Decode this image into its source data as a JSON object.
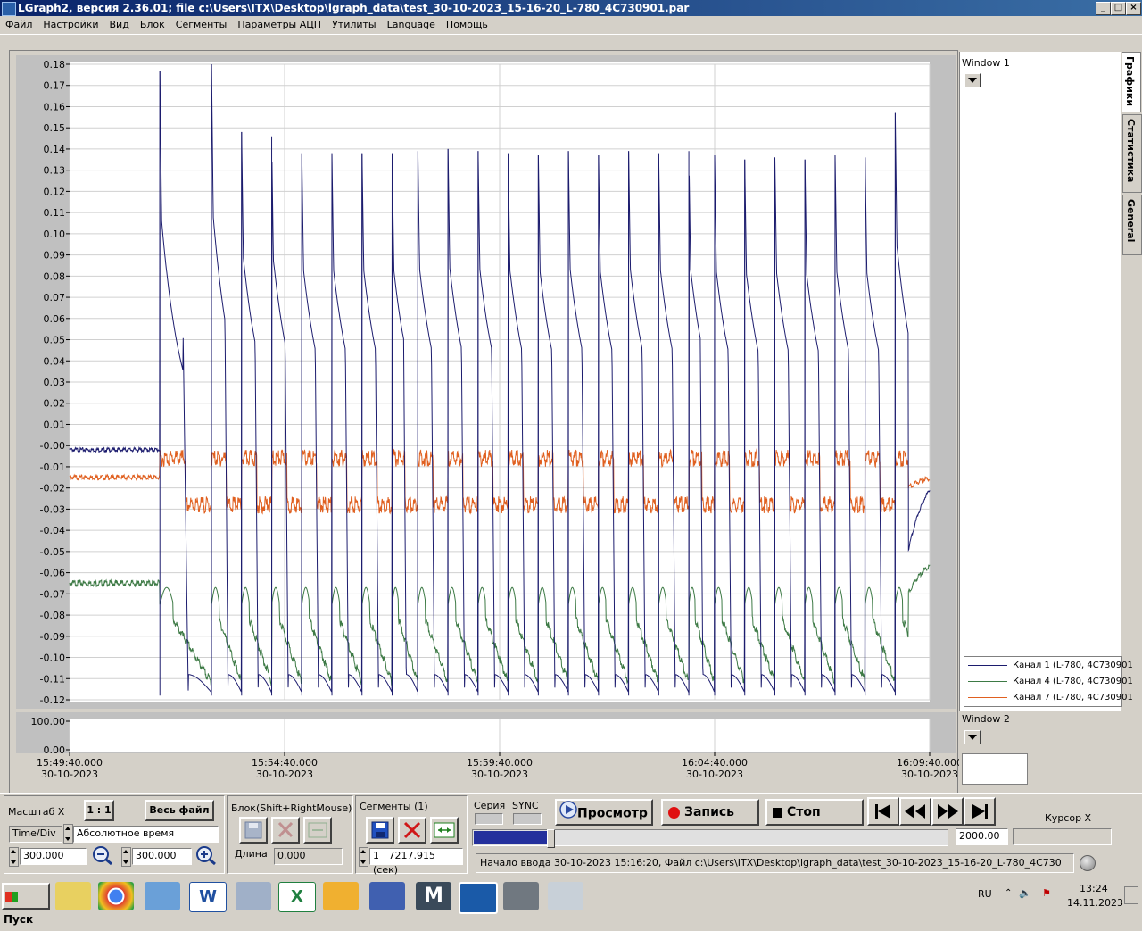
{
  "window": {
    "title": "LGraph2, версия  2.36.01; file c:\\Users\\ITX\\Desktop\\lgraph_data\\test_30-10-2023_15-16-20_L-780_4C730901.par",
    "min_label": "_",
    "max_label": "□",
    "close_label": "×"
  },
  "menu": [
    "Файл",
    "Настройки",
    "Вид",
    "Блок",
    "Сегменты",
    "Параметры АЦП",
    "Утилиты",
    "Language",
    "Помощь"
  ],
  "main_plot": {
    "y_ticks": [
      "0.18",
      "0.17",
      "0.16",
      "0.15",
      "0.14",
      "0.13",
      "0.12",
      "0.11",
      "0.10",
      "0.09",
      "0.08",
      "0.07",
      "0.06",
      "0.05",
      "0.04",
      "0.03",
      "0.02",
      "0.01",
      "-0.00",
      "-0.01",
      "-0.02",
      "-0.03",
      "-0.04",
      "-0.05",
      "-0.06",
      "-0.07",
      "-0.08",
      "-0.09",
      "-0.10",
      "-0.11",
      "-0.12"
    ]
  },
  "lower_plot": {
    "y_ticks": [
      "100.00",
      "0.00"
    ]
  },
  "x_axis": {
    "ticks": [
      {
        "time": "15:49:40.000",
        "date": "30-10-2023"
      },
      {
        "time": "15:54:40.000",
        "date": "30-10-2023"
      },
      {
        "time": "15:59:40.000",
        "date": "30-10-2023"
      },
      {
        "time": "16:04:40.000",
        "date": "30-10-2023"
      },
      {
        "time": "16:09:40.000",
        "date": "30-10-2023"
      }
    ]
  },
  "chart_data": {
    "type": "line",
    "xlabel": "",
    "ylabel": "",
    "x_range": [
      "15:49:40.000",
      "16:09:40.000"
    ],
    "ylim": [
      -0.12,
      0.18
    ],
    "grid": true,
    "legend_position": "right panel, bottom",
    "pulse_count": 25,
    "pulse_times_min": [
      2.1,
      3.3,
      4.0,
      4.7,
      5.4,
      6.1,
      6.8,
      7.5,
      8.1,
      8.8,
      9.5,
      10.2,
      10.9,
      11.6,
      12.3,
      13.0,
      13.7,
      14.4,
      15.0,
      15.7,
      16.4,
      17.1,
      17.8,
      18.5,
      19.2
    ],
    "pulse_peaks": [
      0.177,
      0.18,
      0.148,
      0.146,
      0.138,
      0.138,
      0.138,
      0.138,
      0.139,
      0.14,
      0.139,
      0.138,
      0.137,
      0.139,
      0.137,
      0.139,
      0.138,
      0.139,
      0.137,
      0.135,
      0.136,
      0.135,
      0.137,
      0.136,
      0.157
    ],
    "series": [
      {
        "name": "Канал 1 (L-780, 4C730901",
        "color": "#1c1c6e",
        "baseline_start": -0.002,
        "baseline_end": -0.006,
        "trough": -0.118
      },
      {
        "name": "Канал 4 (L-780, 4C730901",
        "color": "#3d7a45",
        "baseline_start": -0.065,
        "baseline_end": -0.05,
        "trough": -0.112
      },
      {
        "name": "Канал 7 (L-780, 4C730901",
        "color": "#e06020",
        "baseline_start": -0.015,
        "baseline_end": -0.013,
        "trough": -0.04
      }
    ]
  },
  "right_panel": {
    "window1_label": "Window 1",
    "window2_label": "Window 2",
    "tabs": [
      "Графики",
      "Статистика",
      "General"
    ]
  },
  "controls": {
    "scale_x_label": "Масштаб X",
    "ratio_button": "1 : 1",
    "whole_file_button": "Весь файл",
    "time_div_label": "Time/Div",
    "time_mode_value": "Абсолютное время",
    "time_div_value": "300.000",
    "time_div_value2": "300.000",
    "block_label": "Блок(Shift+RightMouse)",
    "length_label": "Длина",
    "length_value": "0.000",
    "segments_label": "Сегменты (1)",
    "segment_num": "1",
    "segment_value": "7217.915 (сек)",
    "series_label": "Серия",
    "sync_label": "SYNC",
    "view_button": "Просмотр",
    "record_button": "Запись",
    "stop_button": "Стоп",
    "progress_fraction": 0.3,
    "progress_value": "2000.00",
    "cursor_label": "Курсор X",
    "status_text": "Начало ввода   30-10-2023 15:16:20, Файл c:\\Users\\ITX\\Desktop\\lgraph_data\\test_30-10-2023_15-16-20_L-780_4C730"
  },
  "taskbar": {
    "start_label": "Пуск",
    "lang": "RU",
    "time": "13:24",
    "date": "14.11.2023"
  }
}
